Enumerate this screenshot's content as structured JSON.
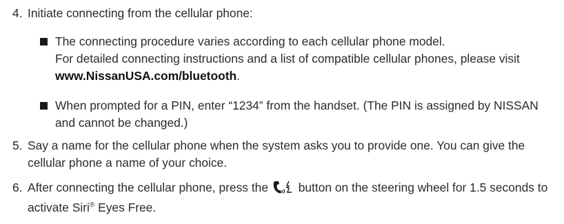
{
  "steps": [
    {
      "num": "4.",
      "text": "Initiate connecting from the cellular phone:"
    },
    {
      "num": "5.",
      "text": "Say a name for the cellular phone when the system asks you to provide one. You can give the cellular phone a name of your choice."
    },
    {
      "num": "6.",
      "before_icon": "After connecting the cellular phone, press the",
      "after_icon": "button on the steering wheel for 1.5 seconds to activate Siri",
      "reg": "®",
      "tail": " Eyes Free."
    }
  ],
  "bullets": [
    {
      "line1": "The connecting procedure varies according to each cellular phone model.",
      "line2": "For detailed connecting instructions and a list of compatible cellular phones, please visit",
      "link": "www.NissanUSA.com/bluetooth",
      "end": "."
    },
    {
      "text": "When prompted for a PIN, enter “1234” from the handset. (The PIN is assigned by NISSAN and cannot be changed.)"
    }
  ],
  "icons": {
    "bullet": "square-bullet-icon",
    "phone": "phone-voice-icon"
  }
}
